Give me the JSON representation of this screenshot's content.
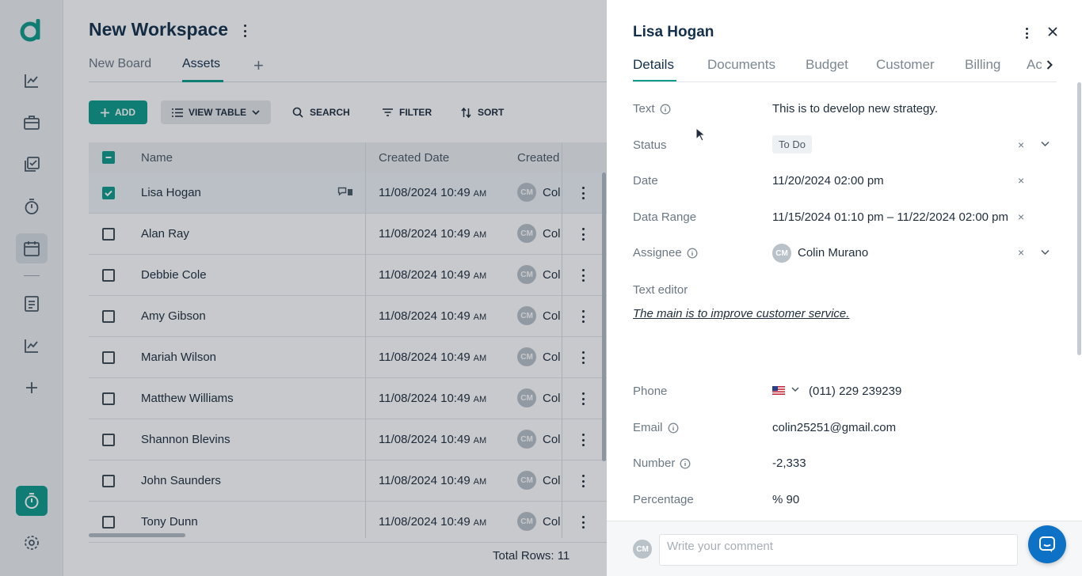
{
  "colors": {
    "accent": "#0e9b8a",
    "title": "#14304d",
    "chat": "#0d71c6"
  },
  "rail": {
    "icons": [
      "logo-icon",
      "analytics-icon",
      "briefcase-icon",
      "tasks-icon",
      "timer-icon",
      "calendar-icon",
      "document-icon",
      "reports-icon",
      "plus-icon",
      "timer-active-icon",
      "settings-icon"
    ]
  },
  "workspace": {
    "title": "New Workspace",
    "tabs": [
      {
        "label": "New Board"
      },
      {
        "label": "Assets"
      }
    ],
    "add_tab": "+"
  },
  "toolbar": {
    "add_label": "ADD",
    "view_label": "VIEW TABLE",
    "search_label": "SEARCH",
    "filter_label": "FILTER",
    "sort_label": "SORT"
  },
  "table": {
    "columns": [
      "Name",
      "Created Date",
      "Created"
    ],
    "rows": [
      {
        "name": "Lisa Hogan",
        "date": "11/08/2024 10:49",
        "ampm": "AM",
        "creator_initials": "CM",
        "creator": "Col"
      },
      {
        "name": "Alan Ray",
        "date": "11/08/2024 10:49",
        "ampm": "AM",
        "creator_initials": "CM",
        "creator": "Col"
      },
      {
        "name": "Debbie Cole",
        "date": "11/08/2024 10:49",
        "ampm": "AM",
        "creator_initials": "CM",
        "creator": "Col"
      },
      {
        "name": "Amy Gibson",
        "date": "11/08/2024 10:49",
        "ampm": "AM",
        "creator_initials": "CM",
        "creator": "Col"
      },
      {
        "name": "Mariah Wilson",
        "date": "11/08/2024 10:49",
        "ampm": "AM",
        "creator_initials": "CM",
        "creator": "Col"
      },
      {
        "name": "Matthew Williams",
        "date": "11/08/2024 10:49",
        "ampm": "AM",
        "creator_initials": "CM",
        "creator": "Col"
      },
      {
        "name": "Shannon Blevins",
        "date": "11/08/2024 10:49",
        "ampm": "AM",
        "creator_initials": "CM",
        "creator": "Col"
      },
      {
        "name": "John Saunders",
        "date": "11/08/2024 10:49",
        "ampm": "AM",
        "creator_initials": "CM",
        "creator": "Col"
      },
      {
        "name": "Tony Dunn",
        "date": "11/08/2024 10:49",
        "ampm": "AM",
        "creator_initials": "CM",
        "creator": "Col"
      }
    ],
    "total_rows": "Total Rows: 11"
  },
  "panel": {
    "title": "Lisa Hogan",
    "tabs": [
      "Details",
      "Documents",
      "Budget",
      "Customer",
      "Billing",
      "Ac"
    ],
    "fields": {
      "text_label": "Text",
      "text_value": "This is to develop new strategy.",
      "status_label": "Status",
      "status_value": "To Do",
      "date_label": "Date",
      "date_value": "11/20/2024 02:00 pm",
      "range_label": "Data Range",
      "range_value": "11/15/2024 01:10 pm – 11/22/2024 02:00 pm",
      "assignee_label": "Assignee",
      "assignee_initials": "CM",
      "assignee_value": "Colin Murano",
      "editor_label": "Text editor",
      "editor_value": "The main is to improve customer service.",
      "phone_label": "Phone",
      "phone_value": "(011) 229 239239",
      "email_label": "Email",
      "email_value": "colin25251@gmail.com",
      "number_label": "Number",
      "number_value": "-2,333",
      "percentage_label": "Percentage",
      "percentage_value": "% 90"
    },
    "clear_symbol": "×",
    "comment": {
      "avatar_initials": "CM",
      "placeholder": "Write your comment"
    }
  }
}
